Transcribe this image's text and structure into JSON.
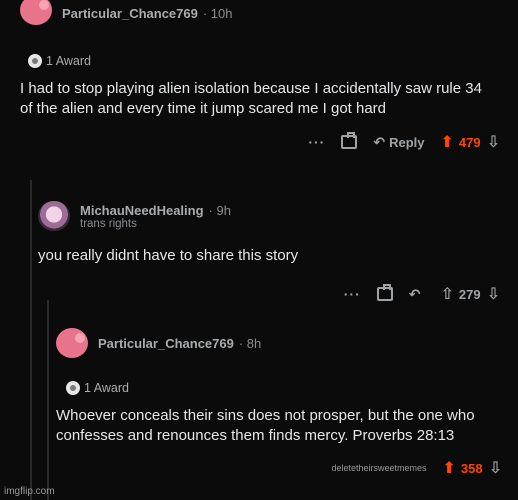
{
  "comments": [
    {
      "username": "Particular_Chance769",
      "time": "· 10h",
      "award": "1 Award",
      "body": "I had to stop playing alien isolation because I accidentally saw rule 34 of the alien and every time it jump scared me I got hard",
      "actions": {
        "more": "···",
        "reply": "Reply",
        "score": "479",
        "voted": true
      }
    },
    {
      "username": "MichauNeedHealing",
      "time": "· 9h",
      "flair": "trans rights",
      "body": "you really didnt have to share this story",
      "actions": {
        "more": "···",
        "score": "279",
        "voted": false
      }
    },
    {
      "username": "Particular_Chance769",
      "time": "· 8h",
      "award": "1 Award",
      "body": "Whoever conceals their sins does not prosper, but the one who confesses and renounces them finds mercy. Proverbs 28:13",
      "actions": {
        "more_text": "deletetheirsweetmemes",
        "score": "358",
        "voted": true
      }
    }
  ],
  "watermark": "imgflip.com",
  "colors": {
    "upvote": "#ff4500",
    "background": "#0b0b0c"
  }
}
